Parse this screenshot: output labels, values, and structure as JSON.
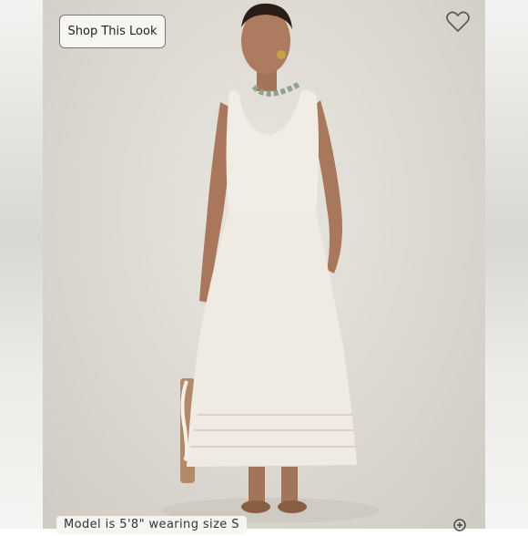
{
  "shop_button": {
    "label": "Shop This Look"
  },
  "caption": {
    "text": "Model is 5'8\" wearing size S"
  },
  "icons": {
    "favorite": "heart-outline-icon",
    "zoom": "zoom-in-icon"
  },
  "colors": {
    "dress": "#f1ede4",
    "backdrop": "#dcd8d1"
  }
}
